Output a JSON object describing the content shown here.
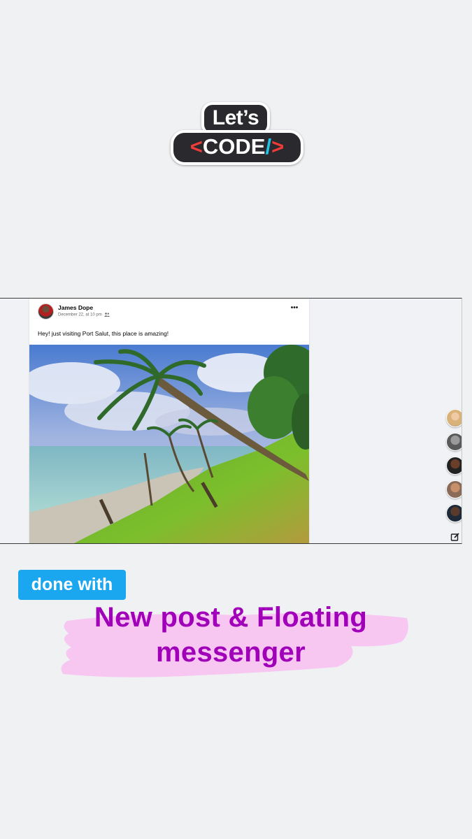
{
  "logo": {
    "top_word": "Let’s",
    "left_bracket": "<",
    "word": "CODE",
    "slash": "/",
    "right_bracket": ">"
  },
  "post": {
    "author": "James Dope",
    "meta": "December 22, at 10 pm",
    "text": "Hey! just visiting Port Salut, this place is amazing!",
    "more_label": "•••"
  },
  "messenger": {
    "contact_count": 5
  },
  "caption": {
    "tag": "done with",
    "headline_line1": "New post & Floating",
    "headline_line2": "messenger"
  },
  "colors": {
    "tag_bg": "#1aa7ef",
    "headline": "#a100b9",
    "brush": "#f7c7f2",
    "logo_red": "#ef3b39",
    "logo_cyan": "#22c3e6"
  }
}
